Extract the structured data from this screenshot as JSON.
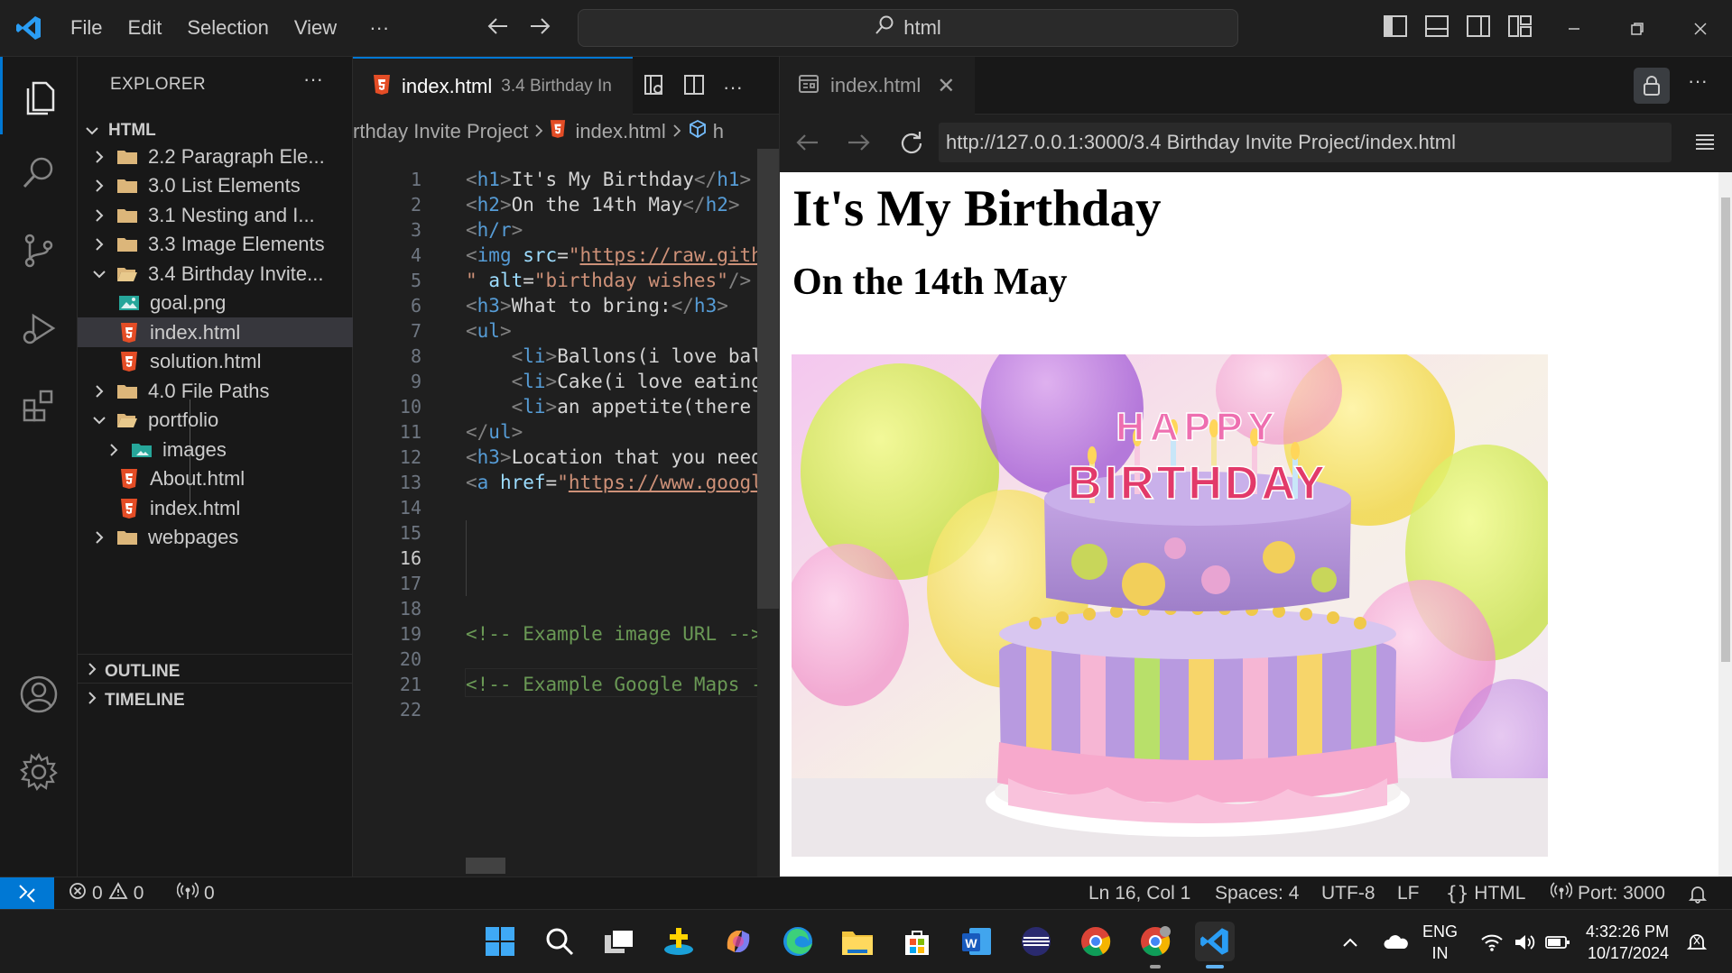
{
  "menu": {
    "file": "File",
    "edit": "Edit",
    "selection": "Selection",
    "view": "View",
    "more": "···"
  },
  "command_center": {
    "search_text": "html"
  },
  "sidebar": {
    "title": "EXPLORER",
    "more": "···",
    "root": "HTML",
    "items": [
      {
        "label": "2.2 Paragraph Ele...",
        "type": "folder",
        "expanded": false
      },
      {
        "label": "3.0 List Elements",
        "type": "folder",
        "expanded": false
      },
      {
        "label": "3.1 Nesting and I...",
        "type": "folder",
        "expanded": false
      },
      {
        "label": "3.3 Image Elements",
        "type": "folder",
        "expanded": false
      },
      {
        "label": "3.4 Birthday Invite...",
        "type": "folder",
        "expanded": true
      },
      {
        "label": "goal.png",
        "type": "image"
      },
      {
        "label": "index.html",
        "type": "html",
        "selected": true
      },
      {
        "label": "solution.html",
        "type": "html"
      },
      {
        "label": "4.0 File Paths",
        "type": "folder",
        "expanded": false
      },
      {
        "label": "portfolio",
        "type": "folder",
        "expanded": true
      },
      {
        "label": "images",
        "type": "image-folder",
        "expanded": false
      },
      {
        "label": "About.html",
        "type": "html"
      },
      {
        "label": "index.html",
        "type": "html"
      },
      {
        "label": "webpages",
        "type": "folder",
        "expanded": false
      }
    ],
    "outline": "OUTLINE",
    "timeline": "TIMELINE"
  },
  "editor": {
    "tab_name": "index.html",
    "tab_desc": "3.4 Birthday In",
    "breadcrumb": {
      "folder": "rthday Invite Project",
      "file": "index.html",
      "symbol": "h"
    },
    "current_line": 16,
    "line_numbers": [
      "1",
      "2",
      "3",
      "4",
      "5",
      "6",
      "7",
      "8",
      "9",
      "10",
      "11",
      "12",
      "13",
      "14",
      "15",
      "16",
      "17",
      "18",
      "19",
      "20",
      "21",
      "22"
    ]
  },
  "browser": {
    "tab_name": "index.html",
    "url": "http://127.0.0.1:3000/3.4 Birthday Invite Project/index.html",
    "page_h1": "It's My Birthday",
    "page_h2": "On the 14th May",
    "cake_text_happy": "HAPPY",
    "cake_text_birthday": "BIRTHDAY"
  },
  "statusbar": {
    "errors": "0",
    "warnings": "0",
    "ports_forwarded": "0",
    "position": "Ln 16, Col 1",
    "spaces": "Spaces: 4",
    "encoding": "UTF-8",
    "eol": "LF",
    "language": "HTML",
    "port": "Port: 3000"
  },
  "taskbar": {
    "lang_top": "ENG",
    "lang_bottom": "IN",
    "time": "4:32:26 PM",
    "date": "10/17/2024"
  },
  "colors": {
    "accent": "#0078d4",
    "status_remote": "#0078d4"
  }
}
